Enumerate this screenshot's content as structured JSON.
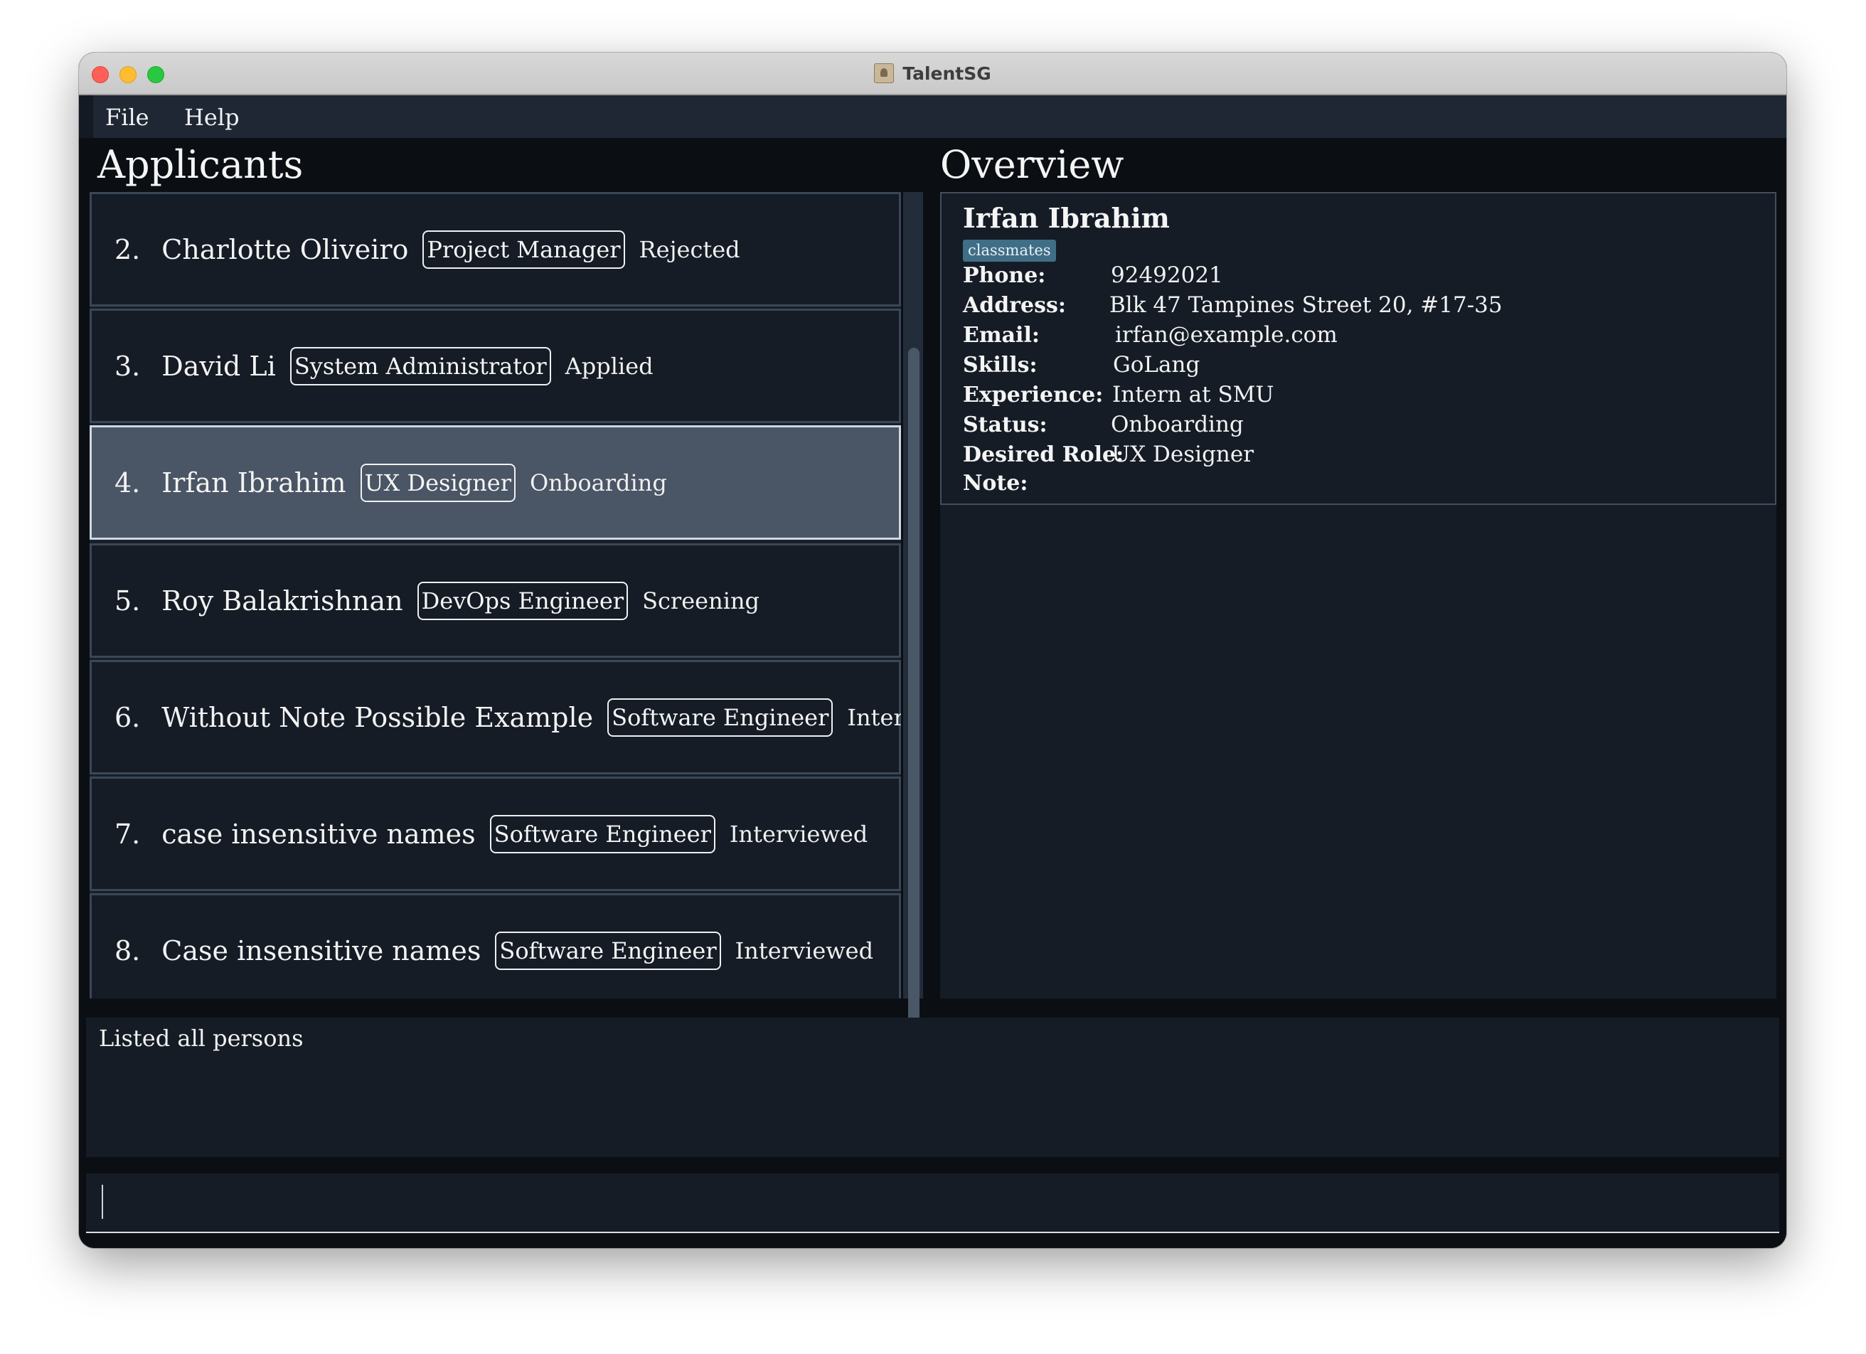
{
  "window": {
    "title": "TalentSG"
  },
  "menu": {
    "file": "File",
    "help": "Help"
  },
  "panels": {
    "applicants_title": "Applicants",
    "overview_title": "Overview"
  },
  "applicants": [
    {
      "index": "2.",
      "name": "Charlotte Oliveiro",
      "role": "Project Manager",
      "status": "Rejected",
      "selected": false
    },
    {
      "index": "3.",
      "name": "David Li",
      "role": "System Administrator",
      "status": "Applied",
      "selected": false
    },
    {
      "index": "4.",
      "name": "Irfan Ibrahim",
      "role": "UX Designer",
      "status": "Onboarding",
      "selected": true
    },
    {
      "index": "5.",
      "name": "Roy Balakrishnan",
      "role": "DevOps Engineer",
      "status": "Screening",
      "selected": false
    },
    {
      "index": "6.",
      "name": "Without Note Possible Example",
      "role": "Software Engineer",
      "status": "Interviewed",
      "selected": false
    },
    {
      "index": "7.",
      "name": "case insensitive names",
      "role": "Software Engineer",
      "status": "Interviewed",
      "selected": false
    },
    {
      "index": "8.",
      "name": "Case insensitive names",
      "role": "Software Engineer",
      "status": "Interviewed",
      "selected": false
    }
  ],
  "overview": {
    "name": "Irfan Ibrahim",
    "tag": "classmates",
    "fields": [
      {
        "label": "Phone:",
        "value": "92492021"
      },
      {
        "label": "Address:",
        "value": "Blk 47 Tampines Street 20, #17-35"
      },
      {
        "label": "Email:",
        "value": "irfan@example.com"
      },
      {
        "label": "Skills:",
        "value": "GoLang"
      },
      {
        "label": "Experience:",
        "value": "Intern at SMU"
      },
      {
        "label": "Status:",
        "value": "Onboarding"
      },
      {
        "label": "Desired Role:",
        "value": "UX Designer"
      },
      {
        "label": "Note:",
        "value": ""
      }
    ]
  },
  "result": {
    "message": "Listed all persons"
  },
  "command": {
    "value": ""
  },
  "colors": {
    "background": "#131a23",
    "selected_card": "#4a5565",
    "tag": "#3f6e86"
  }
}
